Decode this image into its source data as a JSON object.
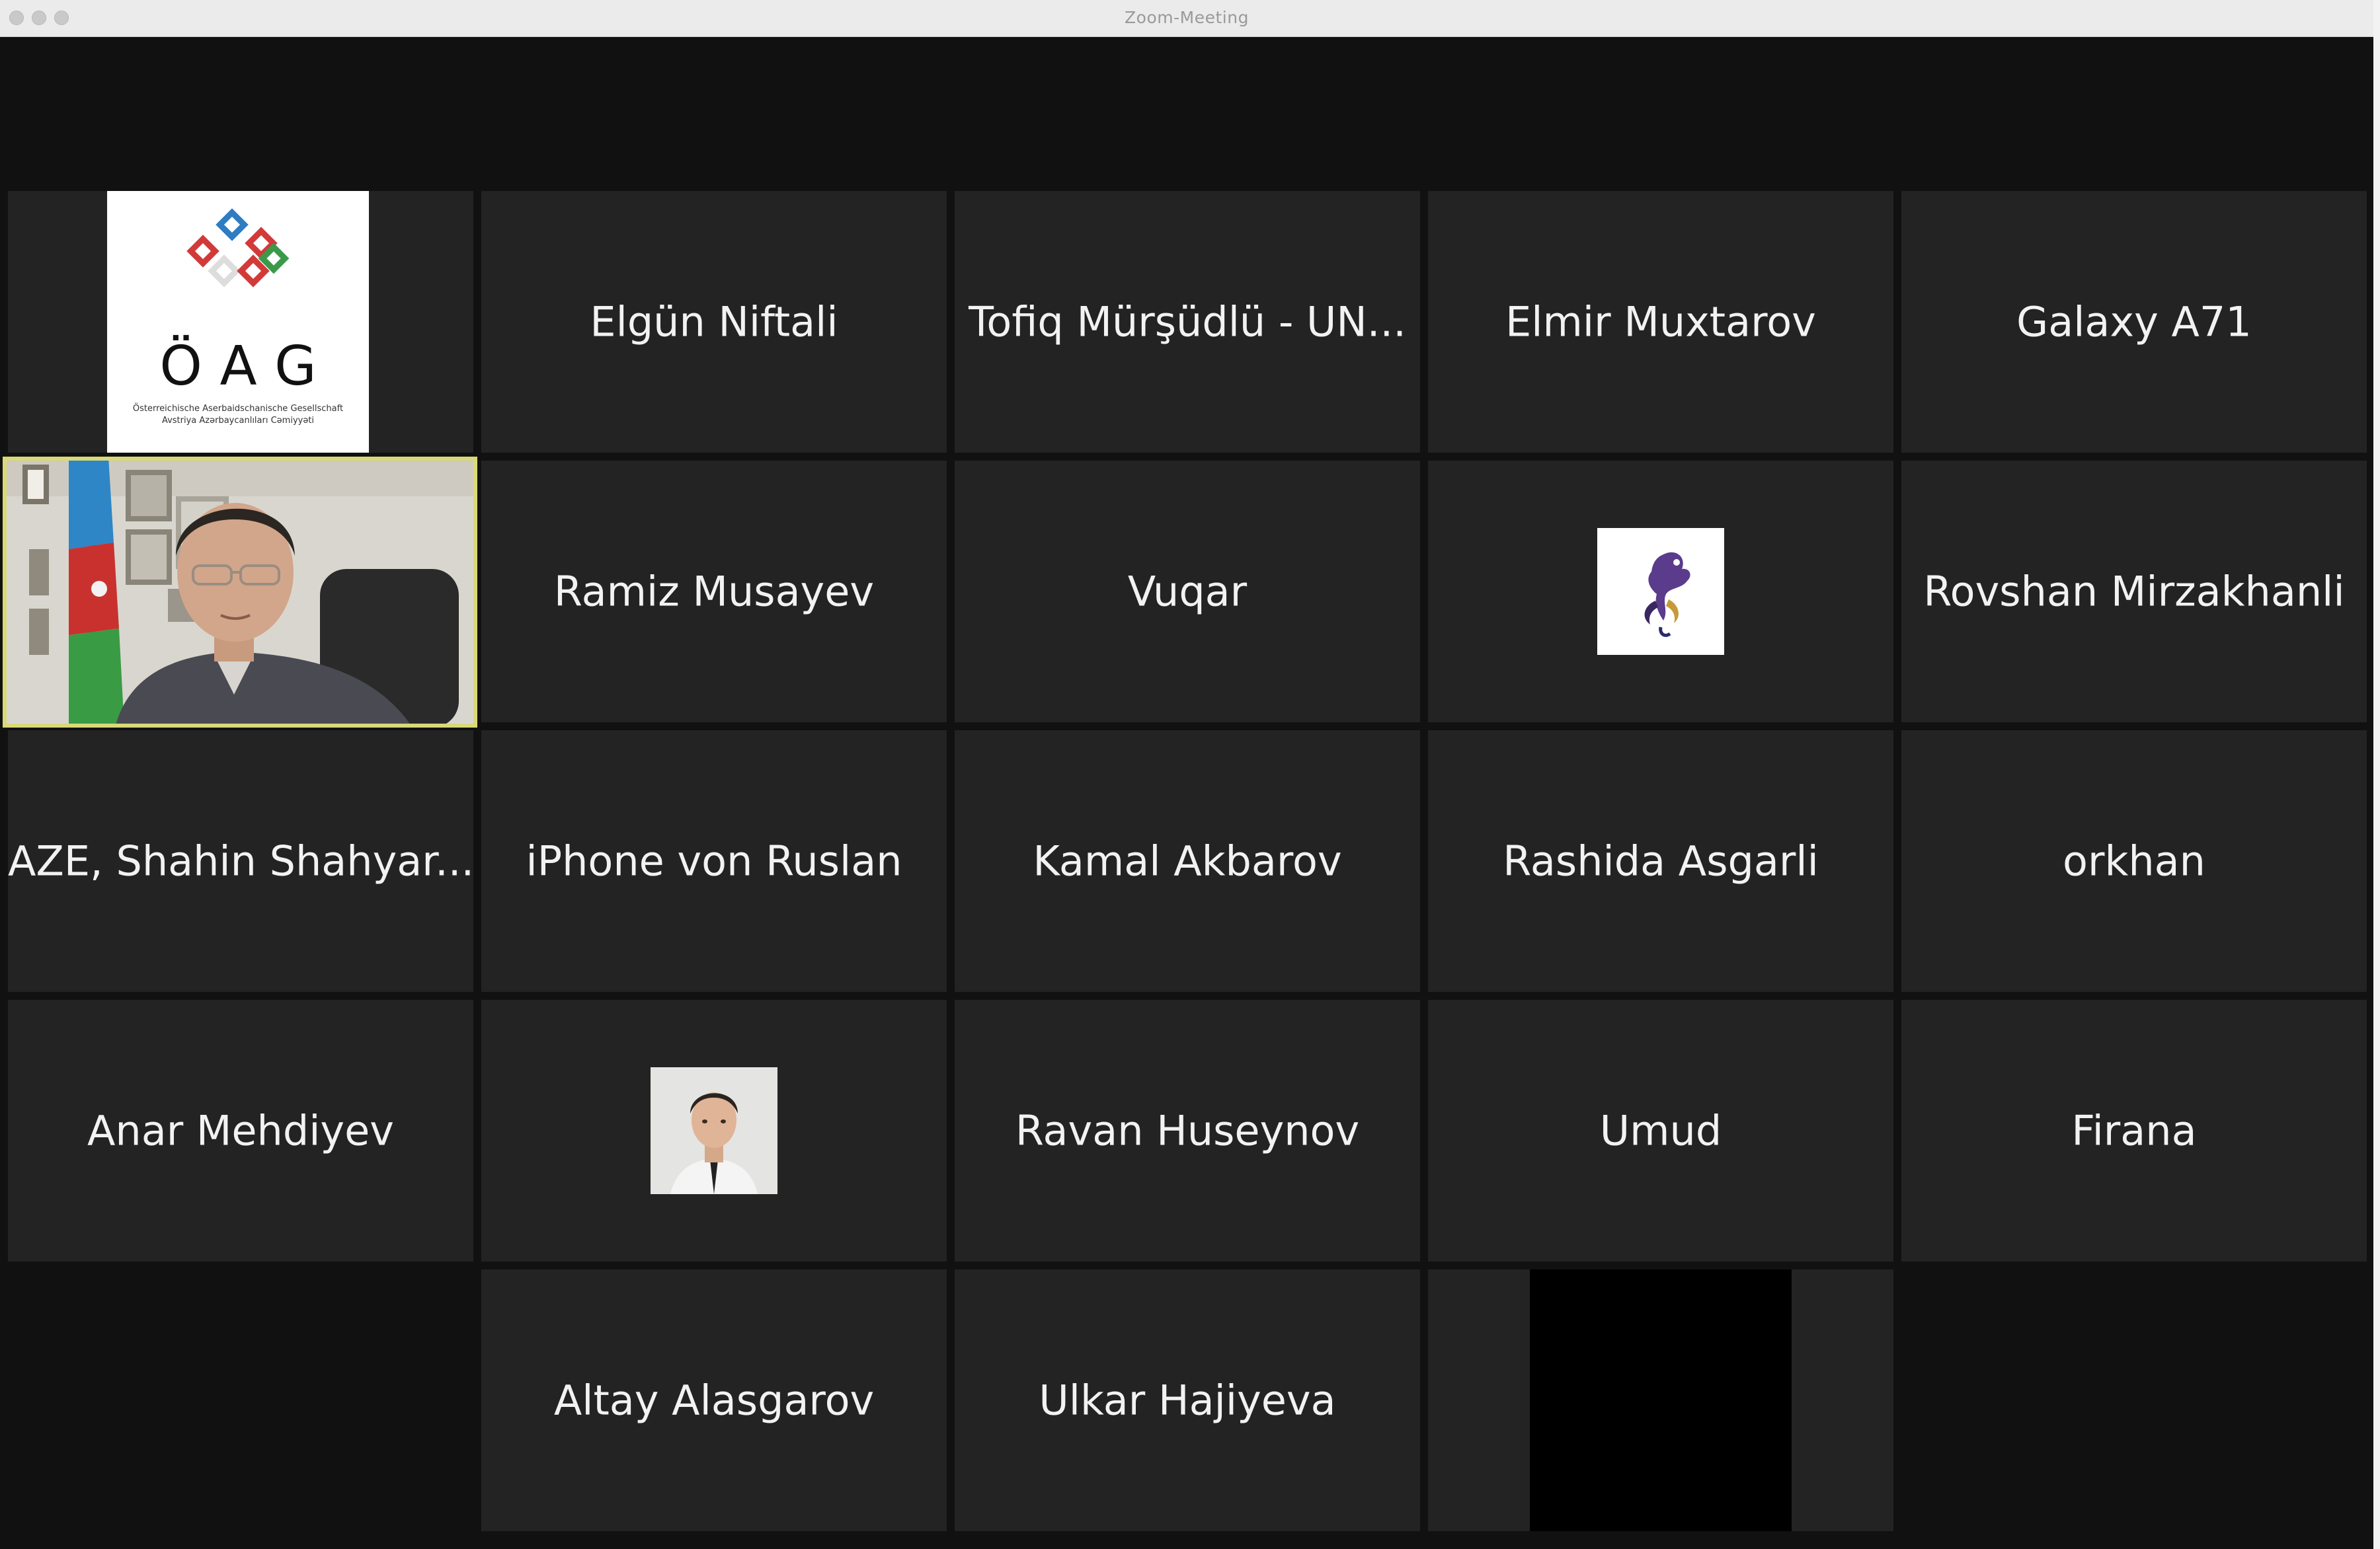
{
  "window": {
    "title": "Zoom-Meeting"
  },
  "participants": [
    {
      "name": "",
      "logo": {
        "word": "ÖAG",
        "line1": "Österreichische Aserbaidschanische Gesellschaft",
        "line2": "Avstriya Azərbaycanlıları Cəmiyyəti"
      }
    },
    {
      "name": "Elgün Niftali"
    },
    {
      "name": "Tofiq Mürşüdlü - UN..."
    },
    {
      "name": "Elmir Muxtarov"
    },
    {
      "name": "Galaxy A71"
    },
    {
      "name": "",
      "video": "speaker-video"
    },
    {
      "name": "Ramiz Musayev"
    },
    {
      "name": "Vuqar"
    },
    {
      "name": "",
      "avatar": "bird-logo-icon"
    },
    {
      "name": "Rovshan Mirzakhanli"
    },
    {
      "name": "AZE, Shahin Shahyar..."
    },
    {
      "name": "iPhone von Ruslan"
    },
    {
      "name": "Kamal Akbarov"
    },
    {
      "name": "Rashida Asgarli"
    },
    {
      "name": "orkhan"
    },
    {
      "name": "Anar Mehdiyev"
    },
    {
      "name": "",
      "avatar": "profile-photo"
    },
    {
      "name": "Ravan Huseynov"
    },
    {
      "name": "Umud"
    },
    {
      "name": "Firana"
    },
    {
      "name": "Altay Alasgarov"
    },
    {
      "name": "Ulkar Hajiyeva"
    },
    {
      "name": "",
      "video": "black-video"
    }
  ],
  "colors": {
    "background": "#111111",
    "tile": "#232323",
    "active_speaker_border": "#d9d977",
    "text": "#f2f2f2"
  }
}
